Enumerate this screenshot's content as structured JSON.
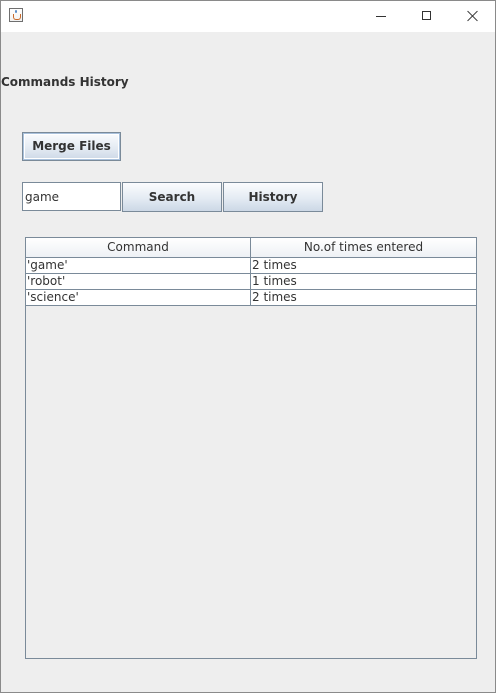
{
  "window": {
    "icon": "java-cup-icon",
    "controls": {
      "minimize_icon": "minimize-icon",
      "maximize_icon": "maximize-icon",
      "close_icon": "close-icon"
    }
  },
  "heading": "Commands History",
  "merge_button": "Merge Files",
  "search": {
    "value": "game",
    "button_label": "Search"
  },
  "history_button": "History",
  "table": {
    "columns": [
      "Command",
      "No.of times entered"
    ],
    "rows": [
      [
        "'game'",
        "2 times"
      ],
      [
        "'robot'",
        "1 times"
      ],
      [
        "'science'",
        "2 times"
      ]
    ]
  }
}
